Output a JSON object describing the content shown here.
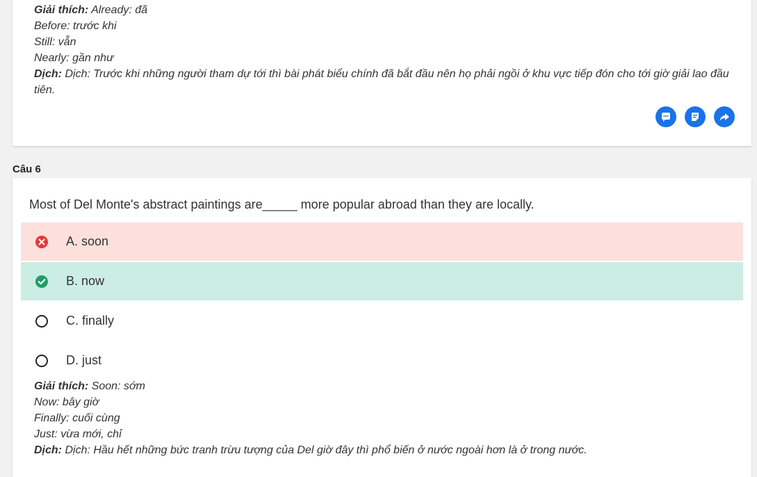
{
  "prev_question": {
    "explanation_label": "Giải thích:",
    "explanation_lines": [
      "Already: đã",
      "Before: trước khi",
      "Still: vẫn",
      "Nearly: gần như"
    ],
    "translation_label": "Dịch:",
    "translation_text": "Dịch: Trước khi những người tham dự tới thì bài phát biểu chính đã bắt đầu nên họ phải ngồi ở khu vực tiếp đón cho tới giờ giải lao đầu tiên."
  },
  "actions": {
    "icons": [
      "comment-icon",
      "note-icon",
      "share-icon"
    ],
    "color": "#1a73e8"
  },
  "question": {
    "label": "Câu 6",
    "text": "Most of Del Monte's abstract paintings are_____ more popular abroad than they are locally.",
    "options": [
      {
        "label": "A. soon",
        "state": "wrong"
      },
      {
        "label": "B. now",
        "state": "correct"
      },
      {
        "label": "C. finally",
        "state": "none"
      },
      {
        "label": "D. just",
        "state": "none"
      }
    ],
    "explanation_label": "Giải thích:",
    "explanation_lines": [
      "Soon: sớm",
      "Now: bây giờ",
      "Finally: cuối cùng",
      "Just: vừa mới, chỉ"
    ],
    "translation_label": "Dịch:",
    "translation_text": "Dịch: Hầu hết những bức tranh trừu tượng của Del giờ đây thì phổ biến ở nước ngoài hơn là ở trong nước."
  },
  "colors": {
    "wrong_bg": "#fde0dc",
    "correct_bg": "#ccede3",
    "wrong_icon": "#e53935",
    "correct_icon": "#1e9e6a"
  }
}
